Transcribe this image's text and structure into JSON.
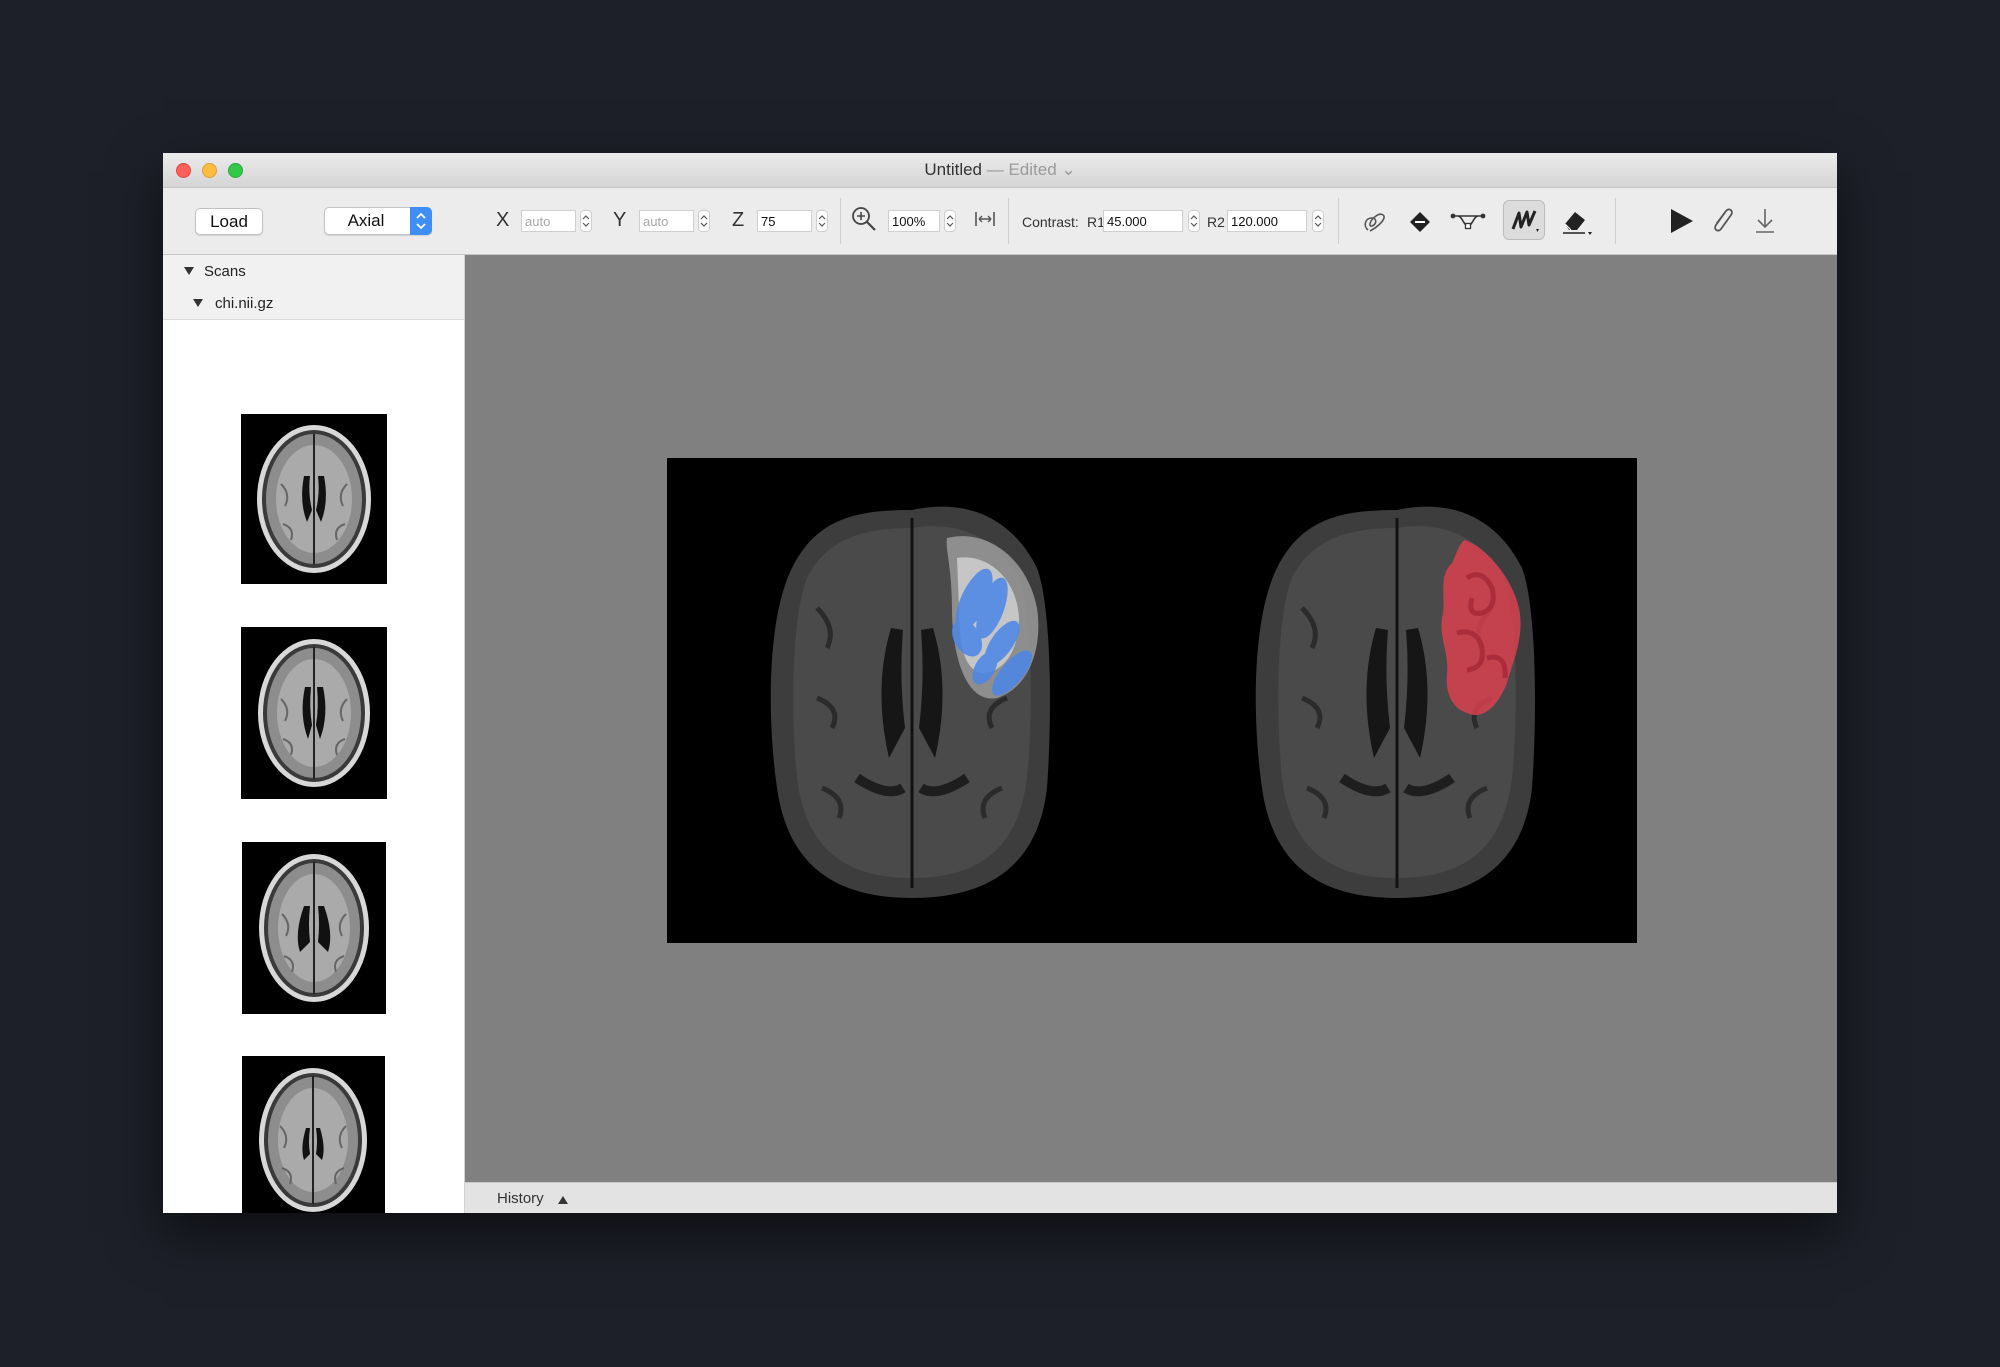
{
  "window": {
    "title": "Untitled",
    "edited_suffix": "— Edited ⌄"
  },
  "toolbar": {
    "load_label": "Load",
    "view_select": {
      "value": "Axial"
    },
    "x_label": "X",
    "x_value": "auto",
    "y_label": "Y",
    "y_value": "auto",
    "z_label": "Z",
    "z_value": "75",
    "zoom_value": "100%",
    "contrast_label": "Contrast:",
    "r1_label": "R1",
    "r1_value": "45.000",
    "r2_label": "R2",
    "r2_value": "120.000"
  },
  "sidebar": {
    "group_label": "Scans",
    "file_label": "chi.nii.gz",
    "thumbnail_count": 4
  },
  "statusbar": {
    "history_label": "History"
  },
  "colors": {
    "background": "#1d2029",
    "accent": "#3f8ef7",
    "annotation_blue": "#4a86e8",
    "annotation_red": "#d9404f",
    "viewer_bg": "#808080"
  },
  "icons": [
    "zoom-in-icon",
    "fit-width-icon",
    "lasso-icon",
    "fill-bucket-icon",
    "bezier-pen-icon",
    "brush-icon",
    "eraser-icon",
    "play-icon",
    "attach-icon",
    "download-icon"
  ]
}
